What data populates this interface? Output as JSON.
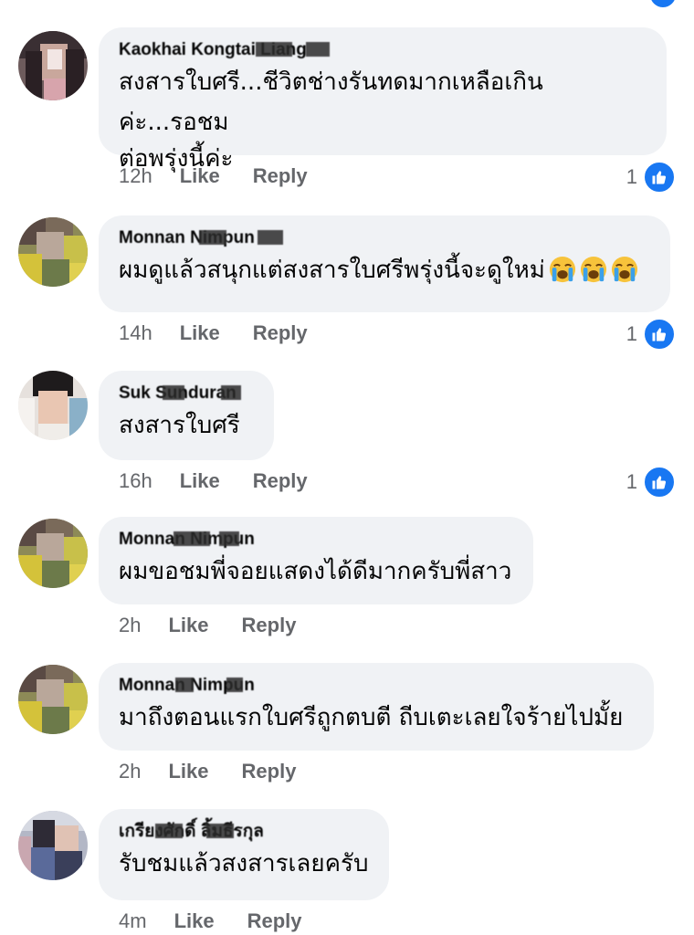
{
  "comments": [
    {
      "author": "Kaokhai Kongtai Liang",
      "text_lines": [
        "สงสารใบศรี...ชีวิตช่างรันทดมากเหลือเกินค่ะ...รอชม",
        "ต่อพรุ่งนี้ค่ะ"
      ],
      "time": "12h",
      "like_label": "Like",
      "reply_label": "Reply",
      "reaction_count": "1",
      "reaction_icon": "thumbs-up-icon"
    },
    {
      "author": "Monnan Nimpun",
      "text_lines": [
        "ผมดูแล้วสนุกแต่สงสารใบศรีพรุ่งนี้จะดูใหม่"
      ],
      "emojis": [
        "loudly-crying-face-icon",
        "loudly-crying-face-icon",
        "loudly-crying-face-icon"
      ],
      "time": "14h",
      "like_label": "Like",
      "reply_label": "Reply",
      "reaction_count": "1",
      "reaction_icon": "thumbs-up-icon"
    },
    {
      "author": "Suk Sunduran",
      "text_lines": [
        "สงสารใบศรี"
      ],
      "time": "16h",
      "like_label": "Like",
      "reply_label": "Reply",
      "reaction_count": "1",
      "reaction_icon": "thumbs-up-icon"
    },
    {
      "author": "Monnan Nimpun",
      "text_lines": [
        "ผมขอชมพี่จอยแสดงได้ดีมากครับพี่สาว"
      ],
      "time": "2h",
      "like_label": "Like",
      "reply_label": "Reply"
    },
    {
      "author": "Monnan Nimpun",
      "text_lines": [
        "มาถึงตอนแรกใบศรีถูกตบตี ถีบเตะเลยใจร้ายไปมั้ย"
      ],
      "time": "2h",
      "like_label": "Like",
      "reply_label": "Reply"
    },
    {
      "author": "เกรียงศักดิ์ ลิ้มธีรกุล",
      "text_lines": [
        "รับชมแล้วสงสารเลยครับ"
      ],
      "time": "4m",
      "like_label": "Like",
      "reply_label": "Reply"
    }
  ],
  "colors": {
    "bubble_bg": "#f0f2f5",
    "meta_text": "#65676b",
    "like_blue": "#1877f2"
  }
}
